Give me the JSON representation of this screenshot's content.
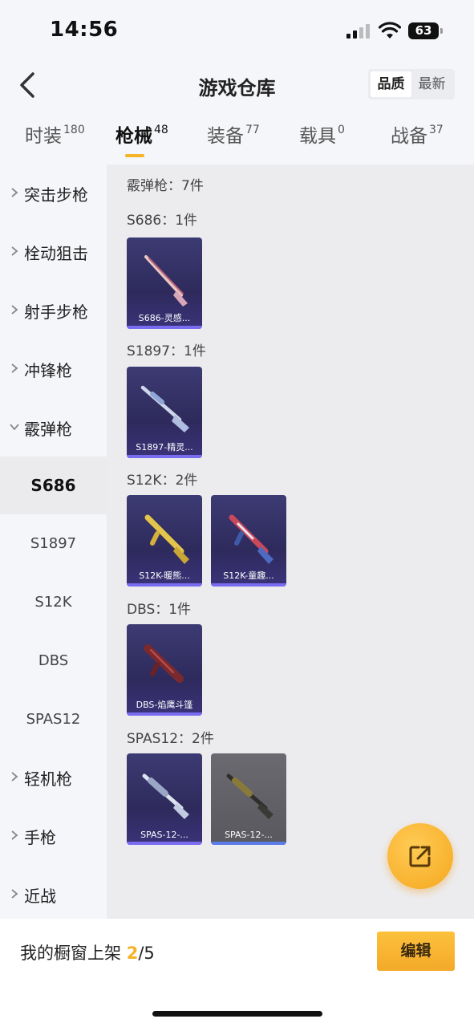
{
  "status_bar": {
    "time": "14:56",
    "battery": "63"
  },
  "header": {
    "title": "游戏仓库",
    "sort_options": [
      "品质",
      "最新"
    ],
    "sort_selected": "品质"
  },
  "tabs": [
    {
      "label": "时装",
      "count": "180"
    },
    {
      "label": "枪械",
      "count": "48"
    },
    {
      "label": "装备",
      "count": "77"
    },
    {
      "label": "载具",
      "count": "0"
    },
    {
      "label": "战备",
      "count": "37"
    }
  ],
  "active_tab": "枪械",
  "sidebar": {
    "categories": [
      "突击步枪",
      "栓动狙击",
      "射手步枪",
      "冲锋枪",
      "霰弹枪",
      "轻机枪",
      "手枪",
      "近战"
    ],
    "expanded_category": "霰弹枪",
    "subcategories": [
      "S686",
      "S1897",
      "S12K",
      "DBS",
      "SPAS12"
    ],
    "selected_subcategory": "S686"
  },
  "content": {
    "category_summary": "霰弹枪：7件",
    "groups": [
      {
        "title": "S686：1件",
        "items": [
          {
            "name": "S686-灵感...",
            "icon": "shotgun-s686-icon"
          }
        ]
      },
      {
        "title": "S1897：1件",
        "items": [
          {
            "name": "S1897-精灵...",
            "icon": "shotgun-s1897-icon"
          }
        ]
      },
      {
        "title": "S12K：2件",
        "items": [
          {
            "name": "S12K-暖熊...",
            "icon": "shotgun-s12k-gold-icon"
          },
          {
            "name": "S12K-童趣...",
            "icon": "shotgun-s12k-flag-icon"
          }
        ]
      },
      {
        "title": "DBS：1件",
        "items": [
          {
            "name": "DBS-焰鹰斗篷",
            "icon": "shotgun-dbs-icon"
          }
        ]
      },
      {
        "title": "SPAS12：2件",
        "items": [
          {
            "name": "SPAS-12-...",
            "icon": "shotgun-spas12-icon"
          },
          {
            "name": "SPAS-12-...",
            "icon": "shotgun-spas12-camo-icon"
          }
        ]
      }
    ]
  },
  "fab": {
    "icon": "share-external-icon"
  },
  "footer": {
    "showcase_label": "我的橱窗上架",
    "showcase_current": "2",
    "showcase_total": "/5",
    "edit_label": "编辑"
  },
  "colors": {
    "accent": "#f5b326",
    "card_bg": "#2e2a5c",
    "rarity_bar": "#7a6cf0"
  }
}
